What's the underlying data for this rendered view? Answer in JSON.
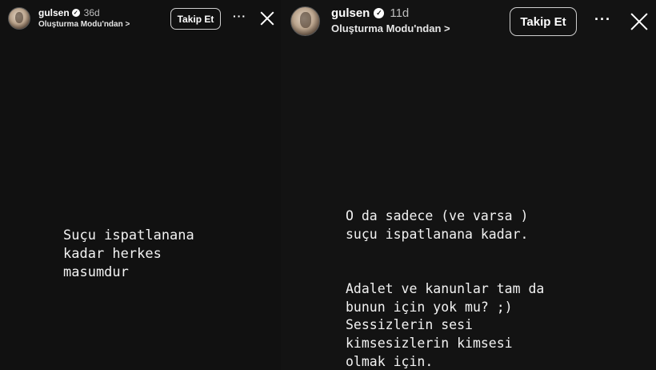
{
  "left_story": {
    "header": {
      "username": "gulsen",
      "verified_icon": "verified-badge-icon",
      "time_ago": "36d",
      "subtitle": "Oluşturma Modu'ndan >",
      "follow_label": "Takip Et",
      "more_label": "···",
      "close_icon": "close-icon"
    },
    "text": "Suçu ispatlanana\nkadar herkes\nmasumdur"
  },
  "right_story": {
    "header": {
      "username": "gulsen",
      "verified_icon": "verified-badge-icon",
      "time_ago": "11d",
      "subtitle": "Oluşturma Modu'ndan >",
      "follow_label": "Takip Et",
      "more_label": "···",
      "close_icon": "close-icon"
    },
    "text": "O da sadece (ve varsa )\nsuçu ispatlanana kadar.\n\n\nAdalet ve kanunlar tam da\nbunun için yok mu? ;)\nSessizlerin sesi\nkimsesizlerin kimsesi\nolmak için."
  },
  "colors": {
    "background": "#111111",
    "text": "#f2f2f2",
    "muted": "#bdbdbd"
  }
}
